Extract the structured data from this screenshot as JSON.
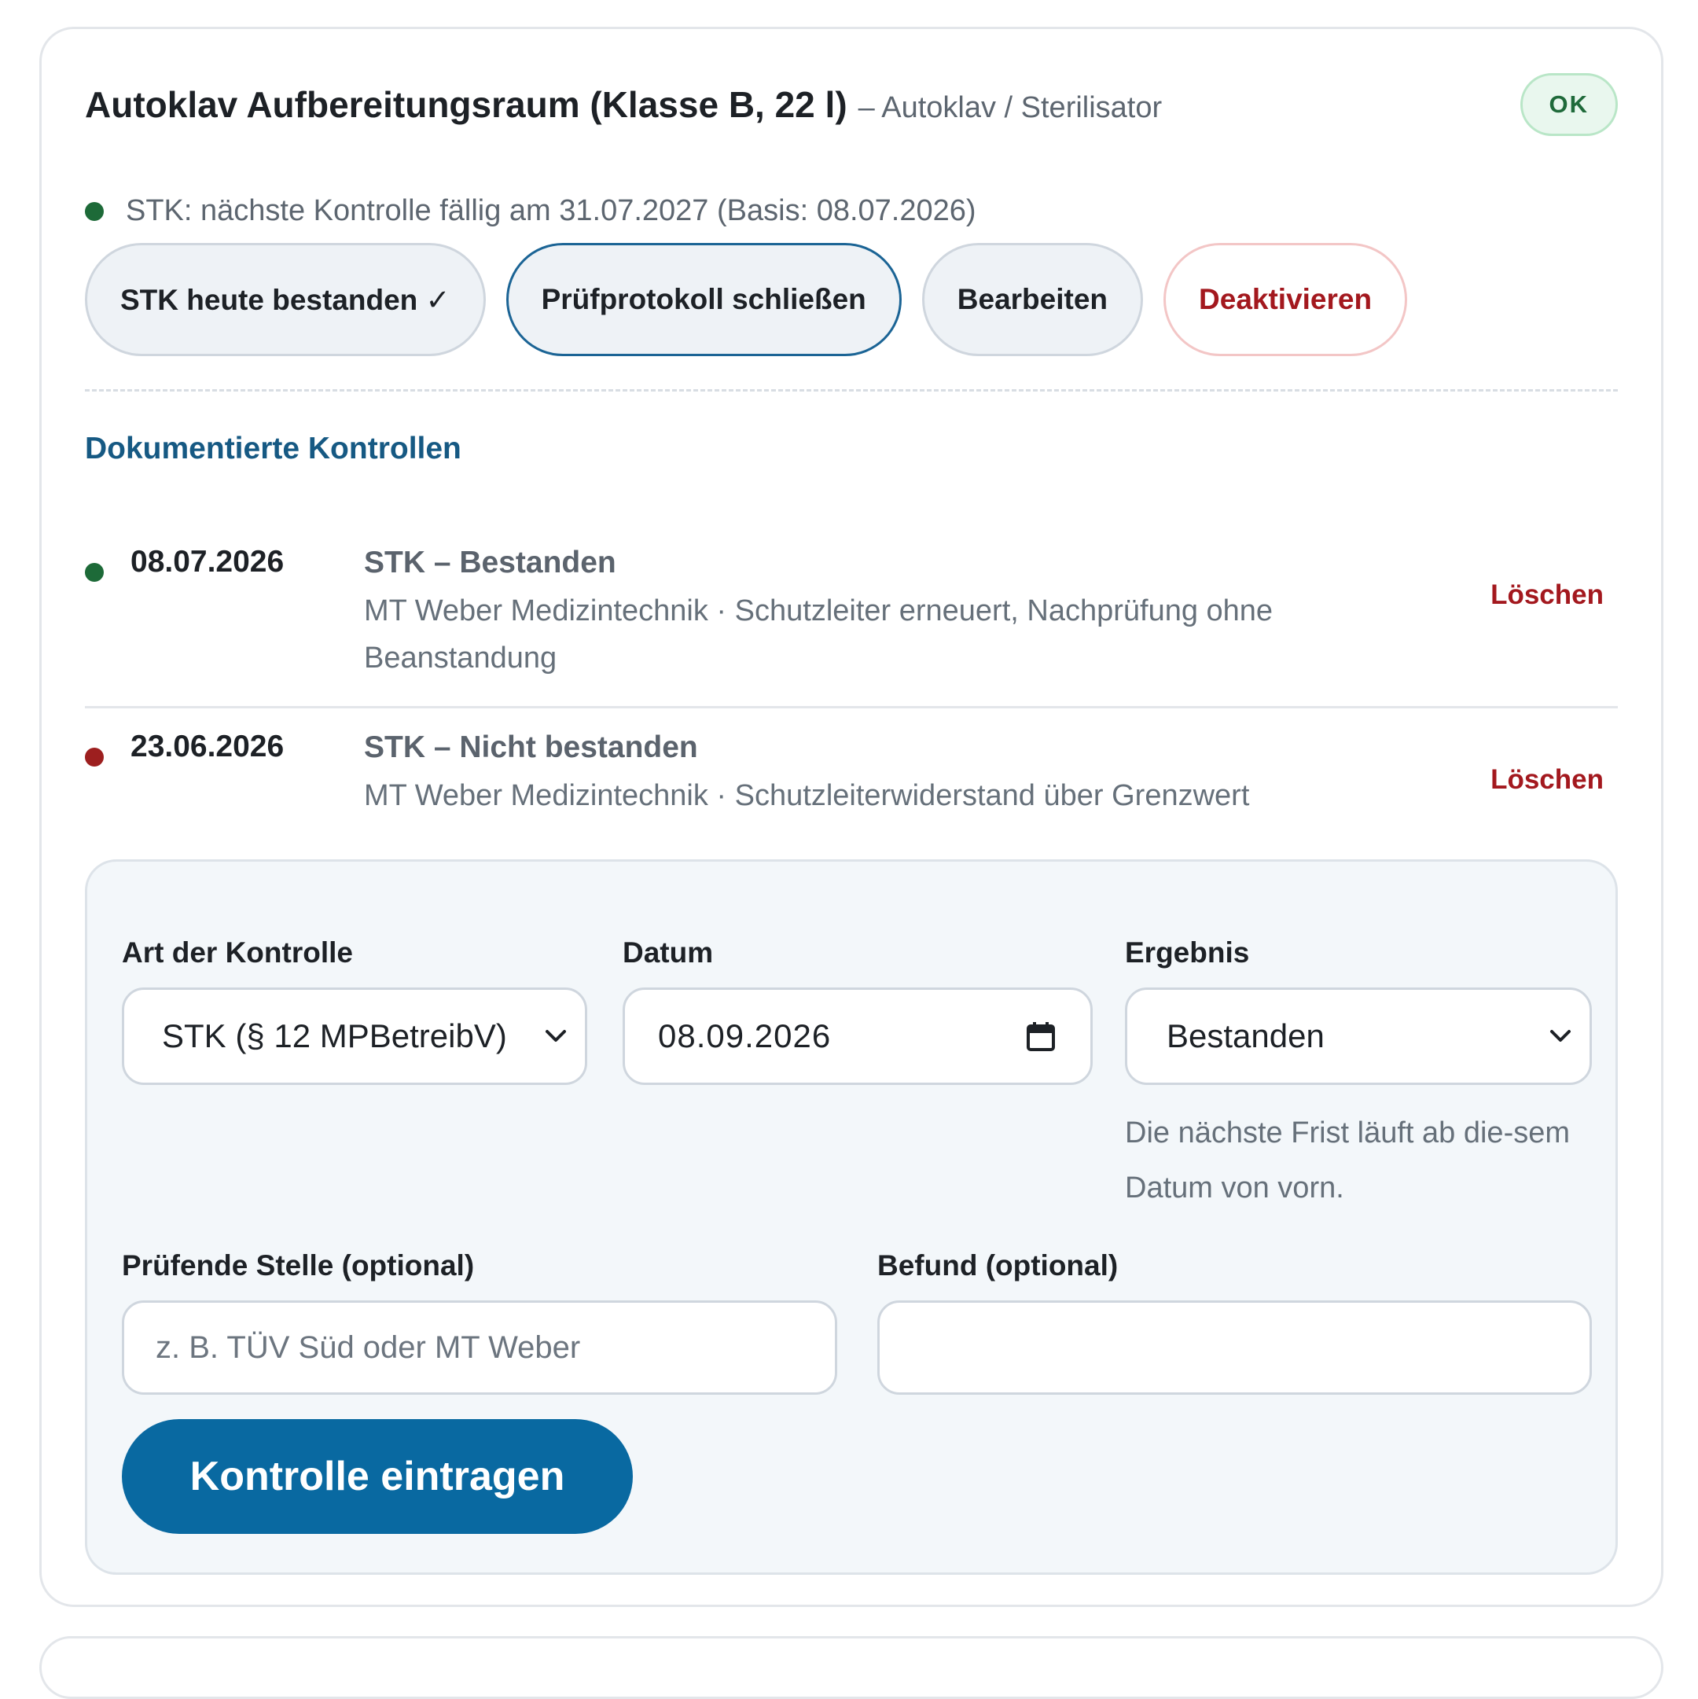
{
  "device": {
    "title": "Autoklav Aufbereitungsraum (Klasse B, 22 l)",
    "subtitle": "– Autoklav / Sterilisator",
    "status_badge": "OK"
  },
  "next_check": {
    "text": "STK: nächste Kontrolle fällig am 31.07.2027 (Basis: 08.07.2026)",
    "indicator_color": "#1d6a38"
  },
  "actions": {
    "passed_today": "STK heute bestanden ✓",
    "close_protocol": "Prüfprotokoll schließen",
    "edit": "Bearbeiten",
    "deactivate": "Deaktivieren"
  },
  "history": {
    "title": "Dokumentierte Kontrollen",
    "entries": [
      {
        "date": "08.07.2026",
        "heading": "STK – Bestanden",
        "description": "MT Weber Medizintechnik · Schutzleiter erneuert, Nachprüfung ohne Beanstandung",
        "status_color": "#1d6a38",
        "delete_label": "Löschen"
      },
      {
        "date": "23.06.2026",
        "heading": "STK – Nicht bestanden",
        "description": "MT Weber Medizintechnik · Schutzleiterwiderstand über Grenzwert",
        "status_color": "#9d1f1f",
        "delete_label": "Löschen"
      }
    ]
  },
  "form": {
    "type_label": "Art der Kontrolle",
    "type_value": "STK (§ 12 MPBetreibV)",
    "date_label": "Datum",
    "date_value": "08.09.2026",
    "result_label": "Ergebnis",
    "result_value": "Bestanden",
    "result_hint": "Die nächste Frist läuft ab die-sem Datum von vorn.",
    "examiner_label": "Prüfende Stelle (optional)",
    "examiner_placeholder": "z. B. TÜV Süd oder MT Weber",
    "findings_label": "Befund (optional)",
    "findings_value": "",
    "submit_label": "Kontrolle eintragen"
  },
  "colors": {
    "accent": "#0969a1",
    "heading_blue": "#165983",
    "danger": "#a3181e",
    "ok_green": "#1f6a3a"
  }
}
